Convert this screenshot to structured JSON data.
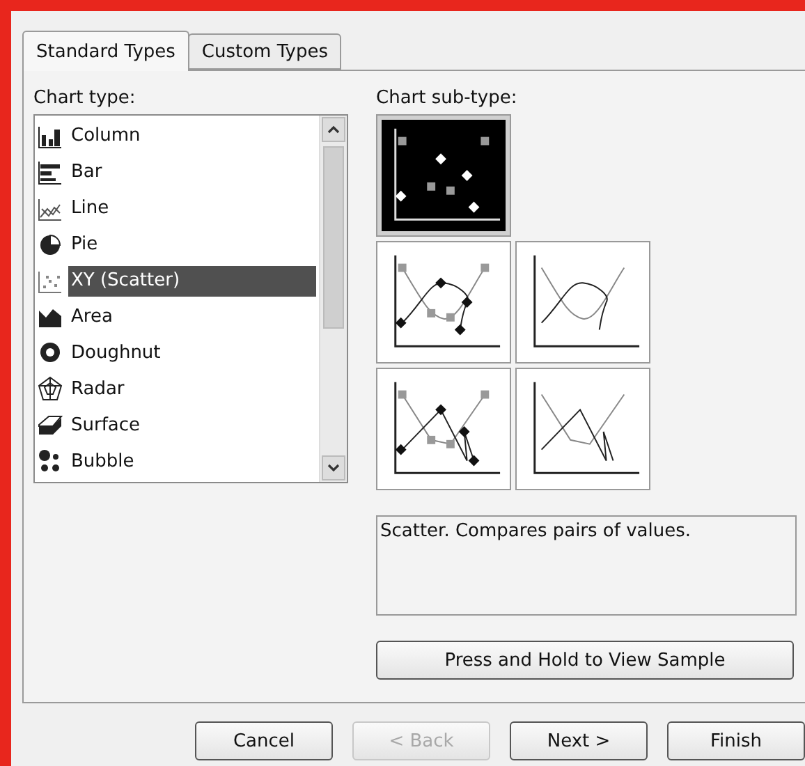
{
  "tabs": [
    {
      "label": "Standard Types",
      "selected": true
    },
    {
      "label": "Custom Types",
      "selected": false
    }
  ],
  "chart_type": {
    "label": "Chart type:",
    "items": [
      {
        "label": "Column",
        "kind": "column",
        "selected": false
      },
      {
        "label": "Bar",
        "kind": "bar",
        "selected": false
      },
      {
        "label": "Line",
        "kind": "line",
        "selected": false
      },
      {
        "label": "Pie",
        "kind": "pie",
        "selected": false
      },
      {
        "label": "XY (Scatter)",
        "kind": "scatter",
        "selected": true
      },
      {
        "label": "Area",
        "kind": "area",
        "selected": false
      },
      {
        "label": "Doughnut",
        "kind": "doughnut",
        "selected": false
      },
      {
        "label": "Radar",
        "kind": "radar",
        "selected": false
      },
      {
        "label": "Surface",
        "kind": "surface",
        "selected": false
      },
      {
        "label": "Bubble",
        "kind": "bubble",
        "selected": false
      }
    ]
  },
  "sub_type": {
    "label": "Chart sub-type:",
    "items": [
      {
        "kind": "markers",
        "selected": true
      },
      {
        "kind": "smooth-markers",
        "selected": false
      },
      {
        "kind": "smooth",
        "selected": false
      },
      {
        "kind": "lines-markers",
        "selected": false
      },
      {
        "kind": "lines",
        "selected": false
      }
    ]
  },
  "description": "Scatter. Compares pairs of values.",
  "sample_button": "Press and Hold to View Sample",
  "buttons": [
    {
      "label": "Cancel",
      "disabled": false
    },
    {
      "label": "< Back",
      "disabled": true
    },
    {
      "label": "Next >",
      "disabled": false
    },
    {
      "label": "Finish",
      "disabled": false
    }
  ]
}
